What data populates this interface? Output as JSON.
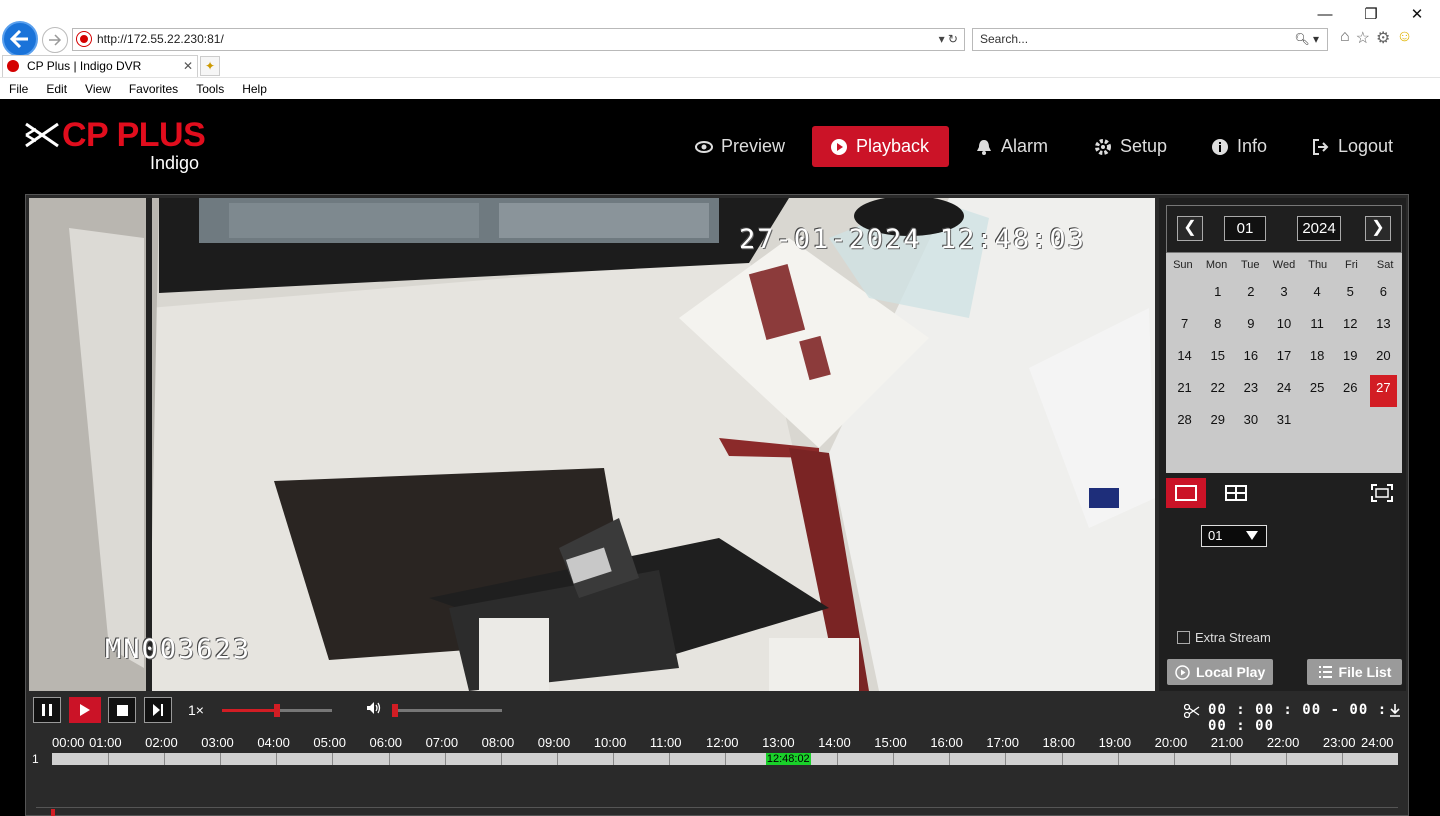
{
  "browser": {
    "url": "http://172.55.22.230:81/",
    "search_placeholder": "Search...",
    "tab_title": "CP Plus | Indigo DVR",
    "menu": [
      "File",
      "Edit",
      "View",
      "Favorites",
      "Tools",
      "Help"
    ]
  },
  "app": {
    "brand": "CP PLUS",
    "product": "Indigo",
    "nav": [
      {
        "label": "Preview",
        "icon": "eye-icon",
        "active": false
      },
      {
        "label": "Playback",
        "icon": "play-circle-icon",
        "active": true
      },
      {
        "label": "Alarm",
        "icon": "bell-icon",
        "active": false
      },
      {
        "label": "Setup",
        "icon": "gear-icon",
        "active": false
      },
      {
        "label": "Info",
        "icon": "info-icon",
        "active": false
      },
      {
        "label": "Logout",
        "icon": "logout-icon",
        "active": false
      }
    ]
  },
  "video": {
    "timestamp_overlay": "27-01-2024 12:48:03",
    "camera_id_overlay": "MN003623"
  },
  "calendar": {
    "month": "01",
    "year": "2024",
    "weekdays": [
      "Sun",
      "Mon",
      "Tue",
      "Wed",
      "Thu",
      "Fri",
      "Sat"
    ],
    "first_weekday_offset": 1,
    "days": [
      "1",
      "2",
      "3",
      "4",
      "5",
      "6",
      "7",
      "8",
      "9",
      "10",
      "11",
      "12",
      "13",
      "14",
      "15",
      "16",
      "17",
      "18",
      "19",
      "20",
      "21",
      "22",
      "23",
      "24",
      "25",
      "26",
      "27",
      "28",
      "29",
      "30",
      "31"
    ],
    "selected_day": "27"
  },
  "panel": {
    "channel": "01",
    "extra_stream_label": "Extra Stream",
    "local_play_label": "Local Play",
    "file_list_label": "File List"
  },
  "controls": {
    "speed": "1×",
    "clip_time": "00 : 00 : 00 - 00 : 00 : 00",
    "progress_fraction": 0.5,
    "volume_fraction": 0.0
  },
  "timeline": {
    "channel": "1",
    "hours": [
      "00:00",
      "01:00",
      "02:00",
      "03:00",
      "04:00",
      "05:00",
      "06:00",
      "07:00",
      "08:00",
      "09:00",
      "10:00",
      "11:00",
      "12:00",
      "13:00",
      "14:00",
      "15:00",
      "16:00",
      "17:00",
      "18:00",
      "19:00",
      "20:00",
      "21:00",
      "22:00",
      "23:00",
      "24:00"
    ],
    "cursor_time": "12:48:02",
    "cursor_hours": 12.8
  },
  "colors": {
    "accent": "#cb1327",
    "brand_red": "#e10d1d",
    "selected_day": "#d21d24",
    "timeline_cursor": "#1ad12a"
  }
}
